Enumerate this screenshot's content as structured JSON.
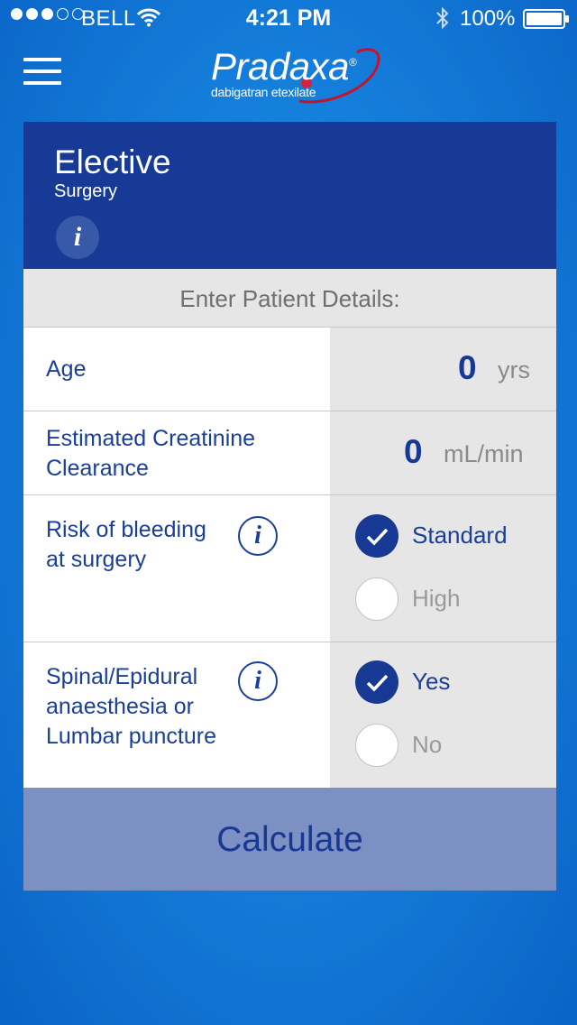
{
  "status_bar": {
    "carrier": "BELL",
    "time": "4:21 PM",
    "battery": "100%"
  },
  "header": {
    "brand": "Pradaxa",
    "brand_mark": "®",
    "generic_name": "dabigatran etexilate",
    "menu_icon": "hamburger-menu-icon"
  },
  "card": {
    "title": "Elective",
    "subtitle": "Surgery",
    "section_label": "Enter Patient Details:",
    "age": {
      "label": "Age",
      "value": "0",
      "unit": "yrs"
    },
    "creatinine": {
      "label_line1": "Estimated Creatinine",
      "label_line2": "Clearance",
      "value": "0",
      "unit": "mL/min"
    },
    "bleeding": {
      "label_line1": "Risk of bleeding",
      "label_line2": "at surgery",
      "options": [
        {
          "label": "Standard",
          "selected": true
        },
        {
          "label": "High",
          "selected": false
        }
      ]
    },
    "anaesthesia": {
      "label_line1": "Spinal/Epidural",
      "label_line2": "anaesthesia or",
      "label_line3": "Lumbar puncture",
      "options": [
        {
          "label": "Yes",
          "selected": true
        },
        {
          "label": "No",
          "selected": false
        }
      ]
    },
    "calculate_label": "Calculate"
  },
  "colors": {
    "header_blue": "#163a96",
    "text_blue": "#1a3f99",
    "button_bg": "#7c90c3",
    "background": "#157fdc"
  }
}
